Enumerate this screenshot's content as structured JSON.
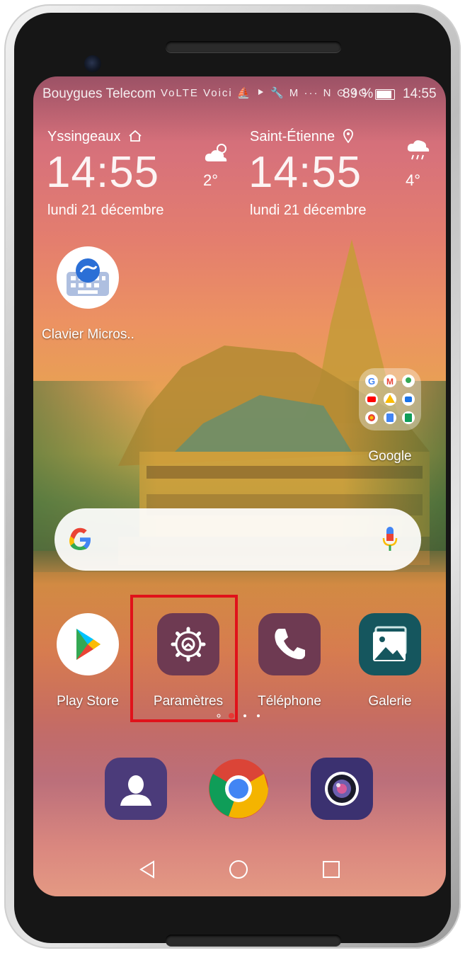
{
  "status_bar": {
    "carrier": "Bouygues Telecom",
    "icons": "VoLTE Voici ⛵ ⯈ 🔧 M ··· N ⊙ 4G",
    "battery_percent": "89 %",
    "time": "14:55"
  },
  "weather": [
    {
      "city": "Yssingeaux",
      "city_icon": "home-icon",
      "time": "14:55",
      "date": "lundi 21 décembre",
      "temp": "2°",
      "weather_icon": "partly-sunny-icon"
    },
    {
      "city": "Saint-Étienne",
      "city_icon": "location-pin-icon",
      "time": "14:55",
      "date": "lundi 21 décembre",
      "temp": "4°",
      "weather_icon": "rain-icon"
    }
  ],
  "apps": {
    "keyboard": "Clavier Micros..",
    "google_folder": "Google",
    "play_store": "Play Store",
    "settings": "Paramètres",
    "phone": "Téléphone",
    "gallery": "Galerie"
  },
  "dock": [
    "contacts-icon",
    "chrome-icon",
    "camera-icon"
  ],
  "navigation": [
    "back-icon",
    "home-icon",
    "recents-icon"
  ],
  "page_indicator": {
    "pages": 4,
    "current": 2
  },
  "colors": {
    "highlight": "#e0121a",
    "app_tile": "#6e3a52",
    "accent_red": "#e53935"
  }
}
